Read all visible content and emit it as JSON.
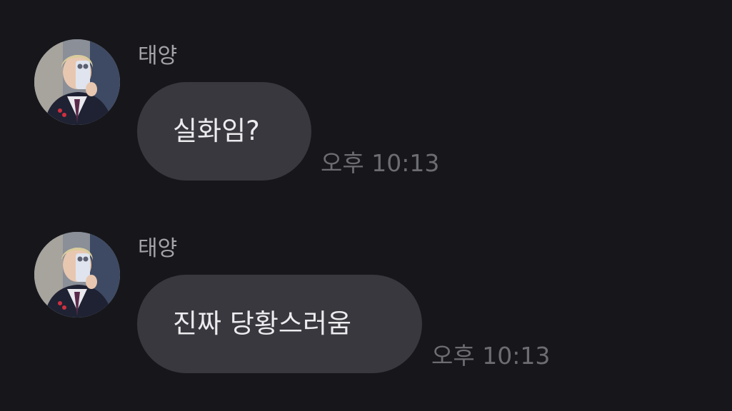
{
  "messages": [
    {
      "sender": "태양",
      "text": "실화임?",
      "time": "오후 10:13"
    },
    {
      "sender": "태양",
      "text": "진짜 당황스러움",
      "time": "오후 10:13"
    }
  ],
  "colors": {
    "background": "#17171b",
    "bubble": "#38383e",
    "bubble_text": "#ececef",
    "sender_name": "#a3a3a8",
    "timestamp": "#6c6c72"
  },
  "icons": {
    "avatar": "profile-photo-avatar"
  }
}
